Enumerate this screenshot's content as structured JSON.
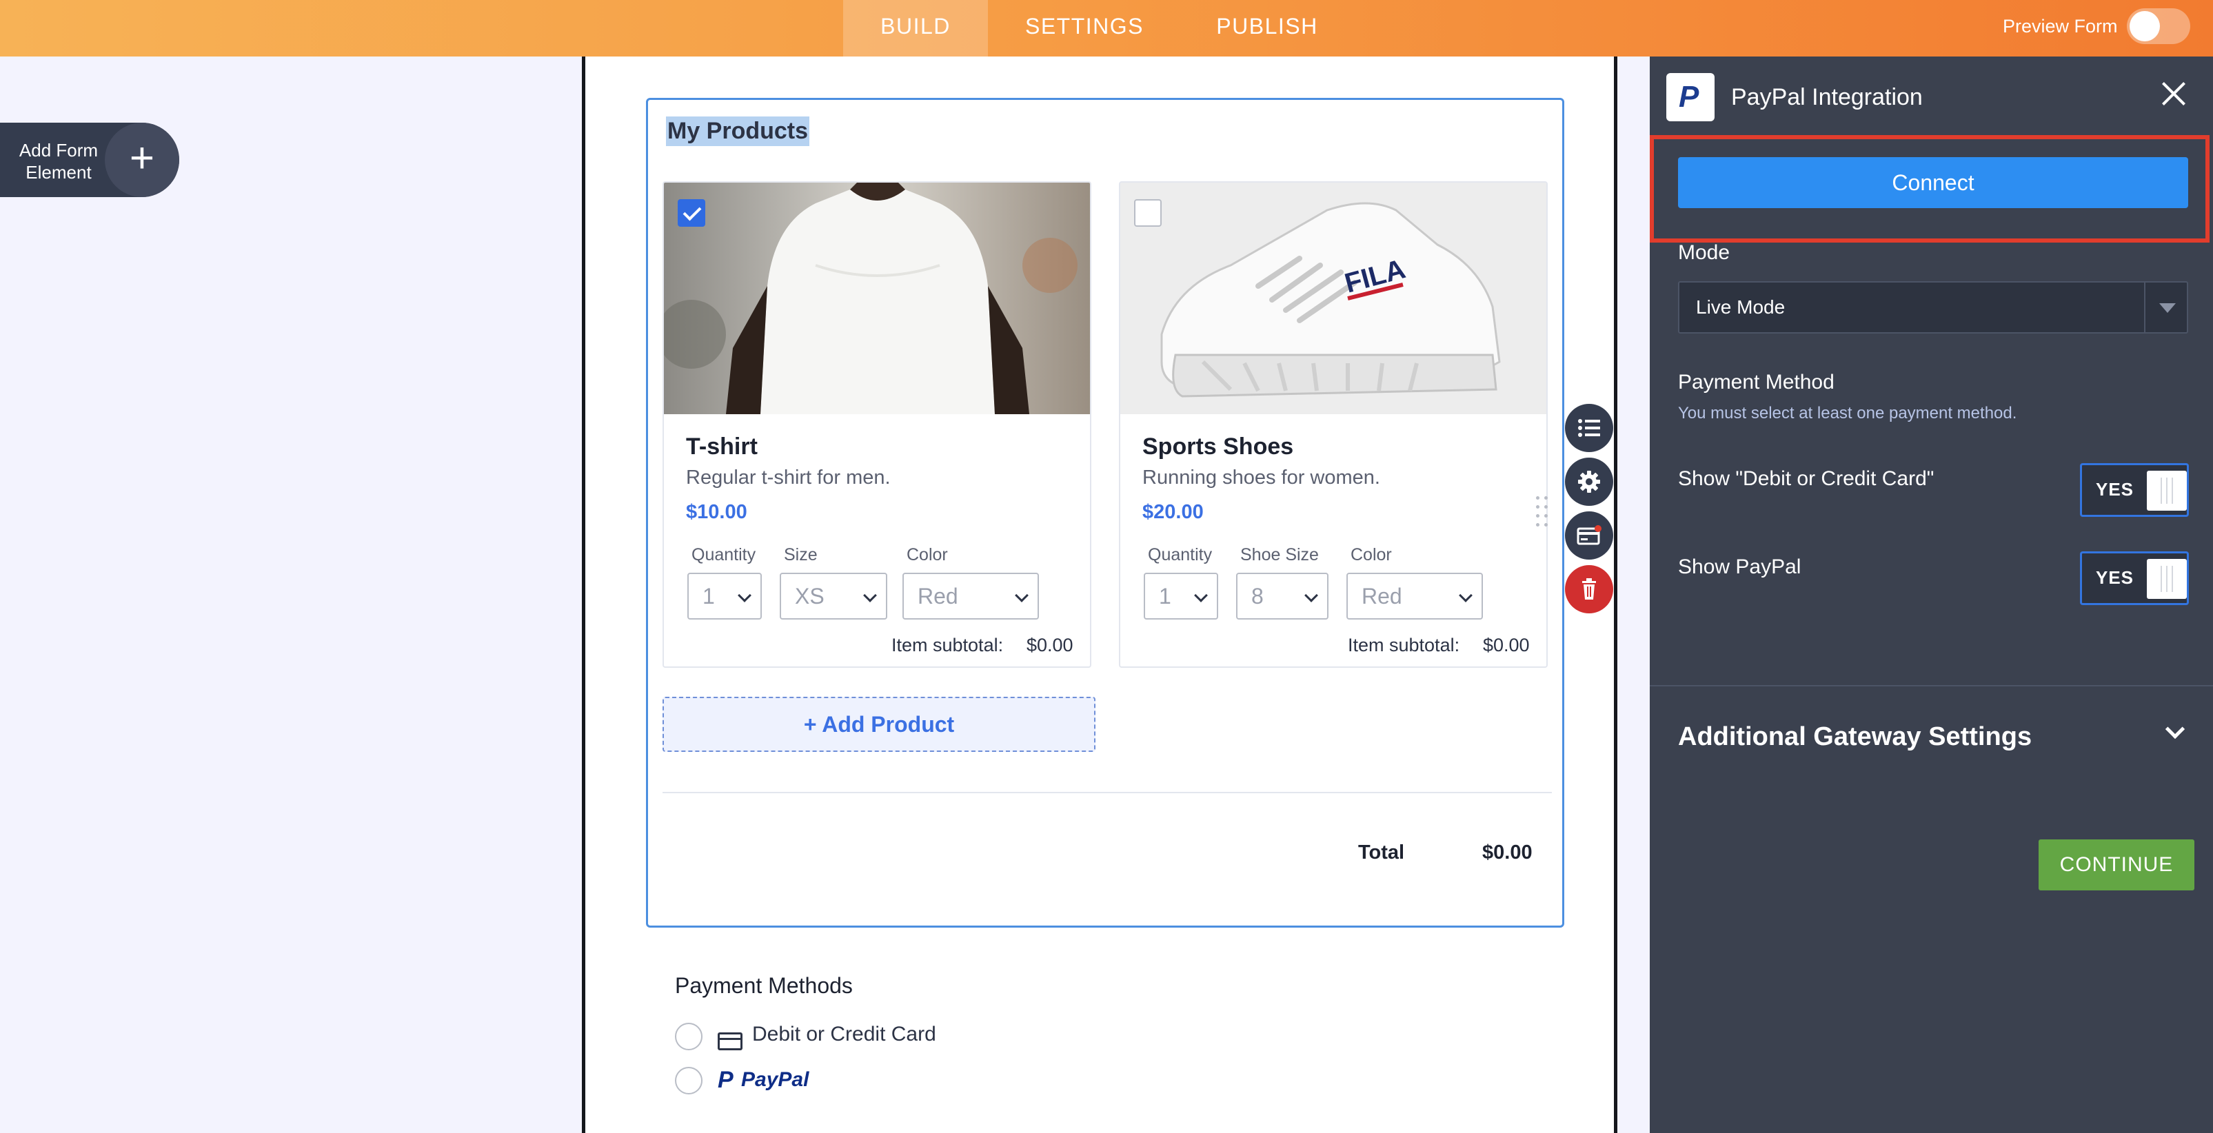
{
  "topbar": {
    "tabs": [
      {
        "label": "BUILD",
        "active": true
      },
      {
        "label": "SETTINGS",
        "active": false
      },
      {
        "label": "PUBLISH",
        "active": false
      }
    ],
    "preview_label": "Preview Form",
    "preview_toggle_on": false
  },
  "sidebar": {
    "add_element_label": "Add Form Element",
    "add_icon": "plus-icon"
  },
  "form": {
    "widget_title": "My Products",
    "products": [
      {
        "name": "T-shirt",
        "description": "Regular t-shirt for men.",
        "price": "$10.00",
        "checked": true,
        "image": "white-tshirt-photo",
        "options": [
          {
            "label": "Quantity",
            "value": "1"
          },
          {
            "label": "Size",
            "value": "XS"
          },
          {
            "label": "Color",
            "value": "Red"
          }
        ],
        "subtotal_label": "Item subtotal:",
        "subtotal_value": "$0.00"
      },
      {
        "name": "Sports Shoes",
        "description": "Running shoes for women.",
        "price": "$20.00",
        "checked": false,
        "image": "white-sneaker-photo",
        "options": [
          {
            "label": "Quantity",
            "value": "1"
          },
          {
            "label": "Shoe Size",
            "value": "8"
          },
          {
            "label": "Color",
            "value": "Red"
          }
        ],
        "subtotal_label": "Item subtotal:",
        "subtotal_value": "$0.00"
      }
    ],
    "add_product_label": "+ Add Product",
    "total_label": "Total",
    "total_value": "$0.00",
    "payment": {
      "title": "Payment Methods",
      "methods": [
        {
          "label": "Debit or Credit Card",
          "icon": "credit-card-icon"
        },
        {
          "label": "PayPal",
          "icon": "paypal-logo"
        }
      ]
    }
  },
  "tools": [
    {
      "name": "properties",
      "icon": "list-icon"
    },
    {
      "name": "settings",
      "icon": "gear-icon"
    },
    {
      "name": "payment",
      "icon": "payment-card-icon"
    },
    {
      "name": "delete",
      "icon": "trash-icon"
    }
  ],
  "panel": {
    "logo": "P",
    "title": "PayPal Integration",
    "connect_label": "Connect",
    "mode_label": "Mode",
    "mode_value": "Live Mode",
    "payment_method_label": "Payment Method",
    "payment_method_hint": "You must select at least one payment method.",
    "options": [
      {
        "label": "Show \"Debit or Credit Card\"",
        "toggle": "YES"
      },
      {
        "label": "Show PayPal",
        "toggle": "YES"
      }
    ],
    "additional_settings_label": "Additional Gateway Settings",
    "continue_label": "CONTINUE"
  },
  "colors": {
    "topbar_start": "#f7b256",
    "topbar_end": "#f27b30",
    "accent_blue": "#2d8ef2",
    "panel_bg": "#3b414f",
    "highlight_red": "#e23d2d",
    "continue_green": "#63a644",
    "delete_red": "#d12f2f"
  }
}
